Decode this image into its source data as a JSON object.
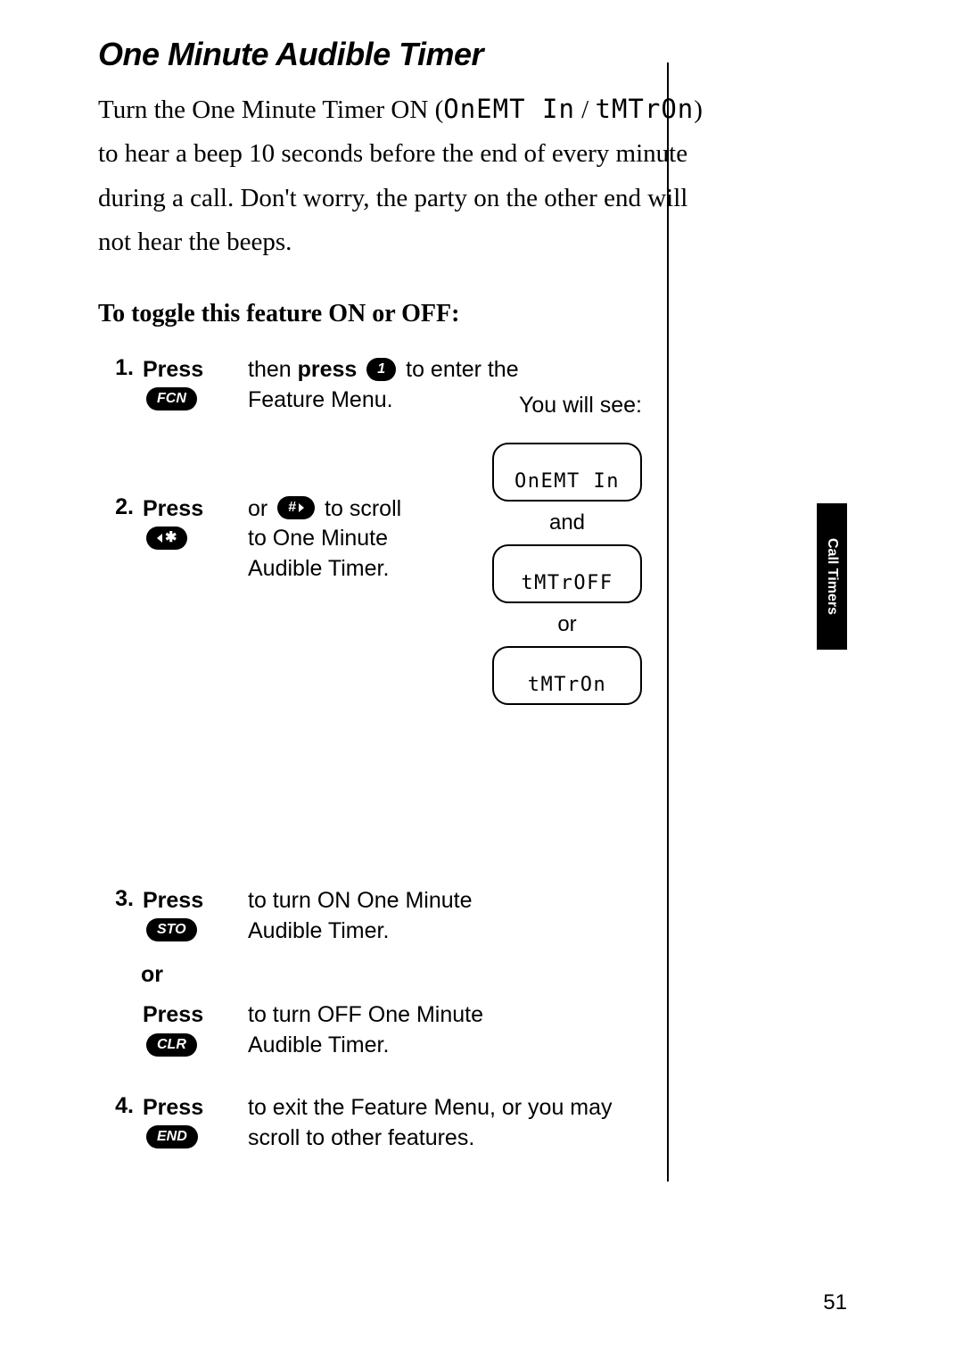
{
  "page_number": "51",
  "side_tab": "Call Timers",
  "title": "One Minute Audible Timer",
  "intro_prefix": "Turn the One Minute Timer ON (",
  "intro_seg1": "OnEMT In",
  "intro_mid": " / ",
  "intro_seg2": "tMTrOn",
  "intro_suffix": ") to hear a beep 10 seconds before the end of every minute during a call. Don't worry, the party on the other end will not hear the beeps.",
  "subheading": "To toggle this feature ON or OFF:",
  "you_will_see": "You will see:",
  "joiner_and": "and",
  "joiner_or": "or",
  "display1": "OnEMT In",
  "display2": "tMTrOFF",
  "display3": "tMTrOn",
  "labels": {
    "press": "Press",
    "then_press": "then ",
    "then_press_bold": "press",
    "or_word": "or",
    "or_small": "or"
  },
  "keys": {
    "fcn": "FCN",
    "one": "1",
    "star": "✱",
    "hash": "#",
    "sto": "STO",
    "clr": "CLR",
    "end": "END"
  },
  "steps": {
    "s1_num": "1.",
    "s1_tail": " to enter the",
    "s1_line2": "Feature Menu.",
    "s2_num": "2.",
    "s2_mid": " or ",
    "s2_tail": " to scroll",
    "s2_line2": "to One Minute",
    "s2_line3": "Audible Timer.",
    "s3_num": "3.",
    "s3_tail": " to turn ON One Minute",
    "s3_line2": "Audible Timer.",
    "s3b_tail": " to turn OFF One Minute",
    "s3b_line2": "Audible Timer.",
    "s4_num": "4.",
    "s4_tail": " to exit the Feature Menu, or you may",
    "s4_line2": "scroll to other features."
  }
}
